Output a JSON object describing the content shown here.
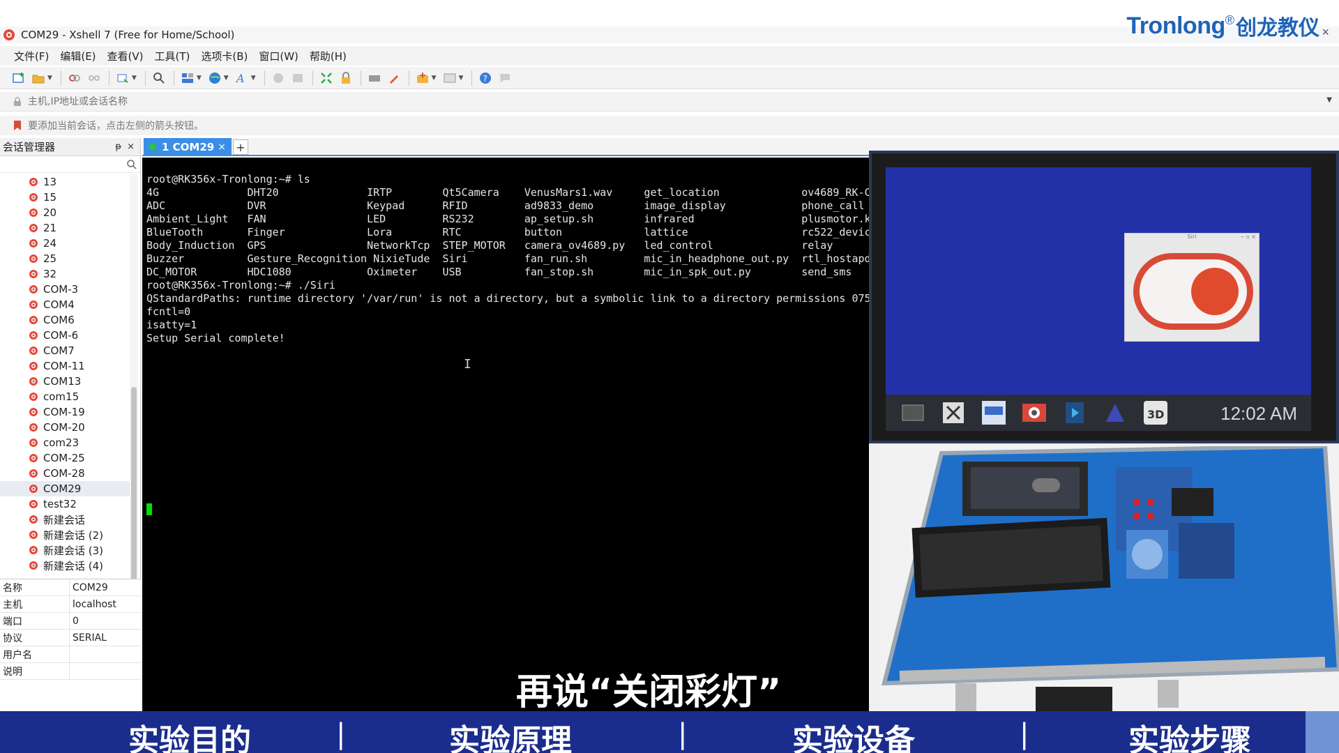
{
  "window": {
    "title": "COM29 - Xshell 7 (Free for Home/School)"
  },
  "brand": {
    "name": "Tronlong",
    "reg": "®",
    "cn": "创龙教仪",
    "close": "×"
  },
  "menu": [
    "文件(F)",
    "编辑(E)",
    "查看(V)",
    "工具(T)",
    "选项卡(B)",
    "窗口(W)",
    "帮助(H)"
  ],
  "address": {
    "placeholder": "主机,IP地址或会话名称"
  },
  "hint": {
    "text": "要添加当前会话，点击左侧的箭头按钮。"
  },
  "sessions": {
    "header": "会话管理器",
    "pin": "ᵽ",
    "close": "×",
    "items": [
      "13",
      "15",
      "20",
      "21",
      "24",
      "25",
      "32",
      "COM-3",
      "COM4",
      "COM6",
      "COM-6",
      "COM7",
      "COM-11",
      "COM13",
      "com15",
      "COM-19",
      "COM-20",
      "com23",
      "COM-25",
      "COM-28",
      "COM29",
      "test32",
      "新建会话",
      "新建会话 (2)",
      "新建会话 (3)",
      "新建会话 (4)"
    ],
    "selected": "COM29"
  },
  "properties": [
    {
      "key": "名称",
      "value": "COM29"
    },
    {
      "key": "主机",
      "value": "localhost"
    },
    {
      "key": "端口",
      "value": "0"
    },
    {
      "key": "协议",
      "value": "SERIAL"
    },
    {
      "key": "用户名",
      "value": ""
    },
    {
      "key": "说明",
      "value": ""
    }
  ],
  "tabs": {
    "active": "1 COM29",
    "close": "×",
    "add": "+"
  },
  "terminal": {
    "lines": [
      "root@RK356x-Tronlong:~# ls",
      "4G              DHT20              IRTP        Qt5Camera    VenusMars1.wav     get_location             ov4689_RK-C",
      "ADC             DVR                Keypad      RFID         ad9833_demo        image_display            phone_call",
      "Ambient_Light   FAN                LED         RS232        ap_setup.sh        infrared                 plusmotor.k",
      "BlueTooth       Finger             Lora        RTC          button             lattice                  rc522_devic",
      "Body_Induction  GPS                NetworkTcp  STEP_MOTOR   camera_ov4689.py   led_control              relay",
      "Buzzer          Gesture_Recognition NixieTude  Siri         fan_run.sh         mic_in_headphone_out.py  rtl_hostapd",
      "DC_MOTOR        HDC1080            Oximeter    USB          fan_stop.sh        mic_in_spk_out.py        send_sms",
      "root@RK356x-Tronlong:~# ./Siri",
      "QStandardPaths: runtime directory '/var/run' is not a directory, but a symbolic link to a directory permissions 075",
      "fcntl=0",
      "isatty=1",
      "Setup Serial complete!"
    ]
  },
  "subtitle": "再说“关闭彩灯”",
  "inset": {
    "window_title": "Siri",
    "window_btns": "‒ ▫ ×",
    "clock": "12:02 AM"
  },
  "nav": [
    "实验目的",
    "实验原理",
    "实验设备",
    "实验步骤"
  ],
  "colors": {
    "accent": "#3a8ee6",
    "brand": "#1f63b8",
    "nav_band": "#1b2d8c",
    "switch_red": "#e04b2e",
    "cursor_green": "#00e000"
  }
}
